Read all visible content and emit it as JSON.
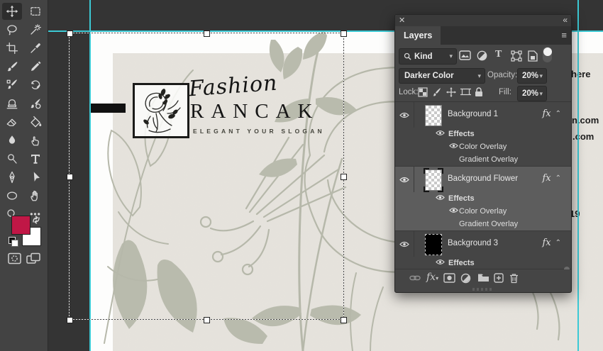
{
  "toolbar": {
    "selected_tool": "move",
    "tools": [
      "move",
      "rectangular-marquee",
      "lasso",
      "magic-wand",
      "crop",
      "eyedropper",
      "brush",
      "pencil",
      "mixer-brush",
      "history-brush",
      "clone-stamp",
      "art-history-brush",
      "eraser",
      "paint-bucket",
      "blur",
      "smudge",
      "dodge",
      "type",
      "pen",
      "path-selection",
      "ellipse-shape",
      "hand",
      "zoom",
      "more-tools"
    ],
    "foreground_color": "#c01746",
    "background_color": "#ffffff",
    "more_tools_glyph": "•••"
  },
  "canvas": {
    "brand_script": "Fashion",
    "brand_name": "RANCAK",
    "tagline": "ELEGANT YOUR SLOGAN",
    "fragments": {
      "f1": "here",
      "f2": "n.com",
      "f3": ".com",
      "f4": "19"
    },
    "card_color": "#e9e6e1",
    "floral_color": "#b6b8aa",
    "guide_color": "#3cc9d4"
  },
  "layers_panel": {
    "title": "Layers",
    "close_icon": "✕",
    "collapse_icon": "«",
    "menu_icon": "≡",
    "filter": {
      "label": "Kind"
    },
    "blend_mode": "Darker Color",
    "opacity": {
      "label": "Opacity:",
      "value": "20%"
    },
    "lock": {
      "label": "Lock:"
    },
    "fill": {
      "label": "Fill:",
      "value": "20%"
    },
    "fx_badge": "fx",
    "fx_chevron": "⌃",
    "layers": [
      {
        "name": "Background 1",
        "visible": true,
        "thumb": "transparent-checker",
        "effects": [
          {
            "name": "Effects",
            "visible": true
          },
          {
            "name": "Color Overlay",
            "visible": true
          },
          {
            "name": "Gradient Overlay",
            "visible": false
          }
        ]
      },
      {
        "name": "Background Flower",
        "visible": true,
        "selected": true,
        "thumb": "transparent-checker-selected",
        "effects": [
          {
            "name": "Effects",
            "visible": true
          },
          {
            "name": "Color Overlay",
            "visible": true
          },
          {
            "name": "Gradient Overlay",
            "visible": false
          }
        ]
      },
      {
        "name": "Background 3",
        "visible": true,
        "thumb": "black-fill",
        "effects": [
          {
            "name": "Effects",
            "visible": true
          }
        ]
      }
    ],
    "footer_icons": [
      "link-layers",
      "layer-style-fx",
      "add-layer-mask",
      "adjustment-layer",
      "new-group-folder",
      "new-layer",
      "delete-layer"
    ]
  }
}
